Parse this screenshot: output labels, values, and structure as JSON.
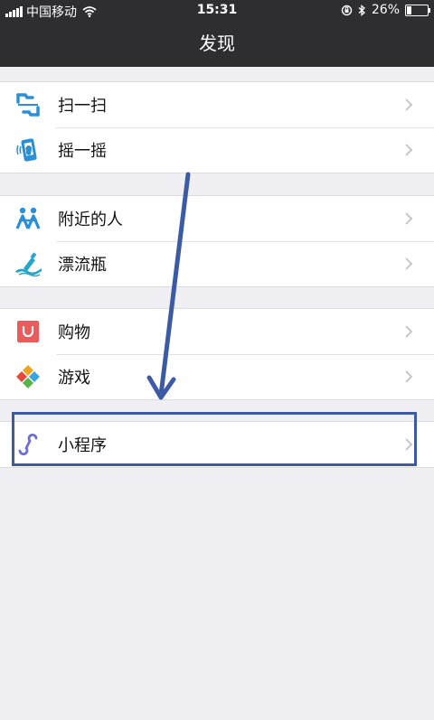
{
  "status_bar": {
    "carrier": "中国移动",
    "time": "15:31",
    "battery": "26%",
    "battery_level": 0.26
  },
  "nav": {
    "title": "发现"
  },
  "groups": [
    {
      "items": [
        {
          "label": "扫一扫",
          "icon": "scan-icon"
        },
        {
          "label": "摇一摇",
          "icon": "shake-icon"
        }
      ]
    },
    {
      "items": [
        {
          "label": "附近的人",
          "icon": "people-nearby-icon"
        },
        {
          "label": "漂流瓶",
          "icon": "drift-bottle-icon"
        }
      ]
    },
    {
      "items": [
        {
          "label": "购物",
          "icon": "shopping-icon"
        },
        {
          "label": "游戏",
          "icon": "games-icon"
        }
      ]
    },
    {
      "items": [
        {
          "label": "小程序",
          "icon": "mini-programs-icon"
        }
      ]
    }
  ],
  "colors": {
    "nav_bg": "#2e2e30",
    "page_bg": "#efeff4",
    "annotation": "#3d5aa5",
    "chevron": "#c7c7cc"
  }
}
